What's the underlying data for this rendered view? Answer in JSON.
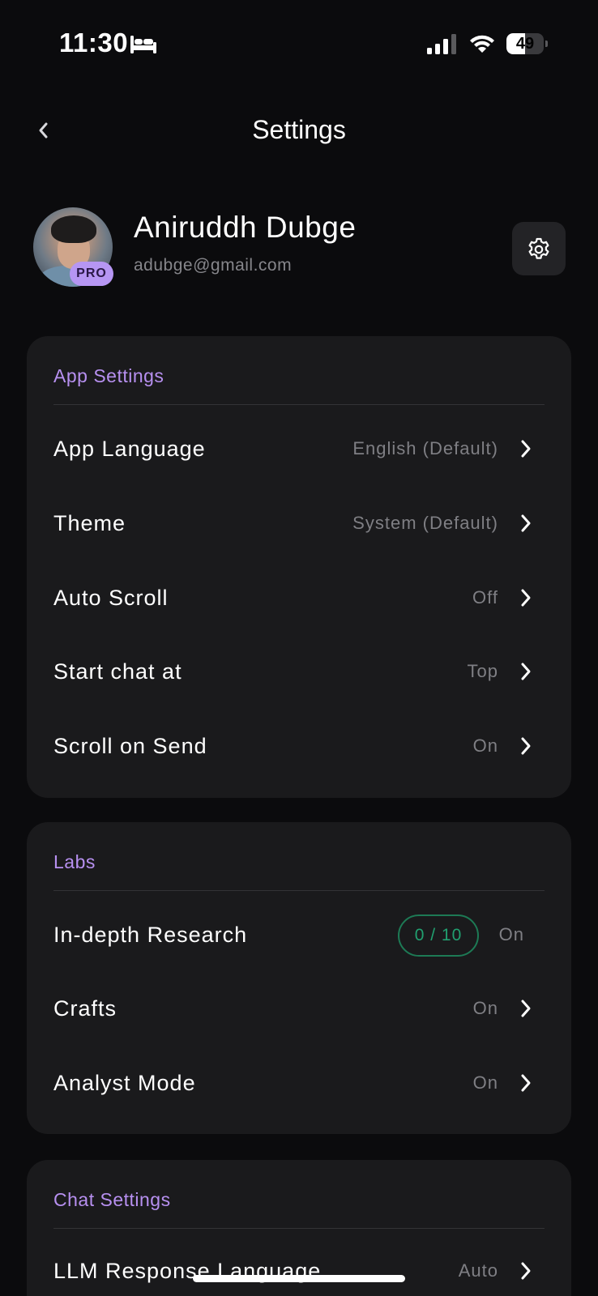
{
  "status_bar": {
    "time": "11:30",
    "battery_level": "49",
    "battery_fraction": 0.49,
    "icons": [
      "bed-icon",
      "signal-icon",
      "wifi-icon",
      "battery-icon"
    ]
  },
  "nav": {
    "title": "Settings",
    "back_icon": "chevron-left-icon"
  },
  "profile": {
    "name": "Aniruddh Dubge",
    "email": "adubge@gmail.com",
    "badge": "PRO",
    "settings_icon": "gear-icon"
  },
  "sections": {
    "app_settings": {
      "title": "App Settings",
      "rows": [
        {
          "label": "App Language",
          "value": "English (Default)"
        },
        {
          "label": "Theme",
          "value": "System (Default)"
        },
        {
          "label": "Auto Scroll",
          "value": "Off"
        },
        {
          "label": "Start chat at",
          "value": "Top"
        },
        {
          "label": "Scroll on Send",
          "value": "On"
        }
      ]
    },
    "labs": {
      "title": "Labs",
      "rows": [
        {
          "label": "In-depth Research",
          "counter": "0 / 10",
          "value": "On"
        },
        {
          "label": "Crafts",
          "value": "On"
        },
        {
          "label": "Analyst Mode",
          "value": "On"
        }
      ]
    },
    "chat_settings": {
      "title": "Chat Settings",
      "rows": [
        {
          "label": "LLM Response Language",
          "value": "Auto"
        }
      ]
    }
  },
  "colors": {
    "background": "#0b0b0d",
    "card": "#1a1a1c",
    "section_header": "#b790f0",
    "pro_badge": "#b696f3",
    "counter_green": "#21a070",
    "secondary_text": "#7f7f84"
  }
}
